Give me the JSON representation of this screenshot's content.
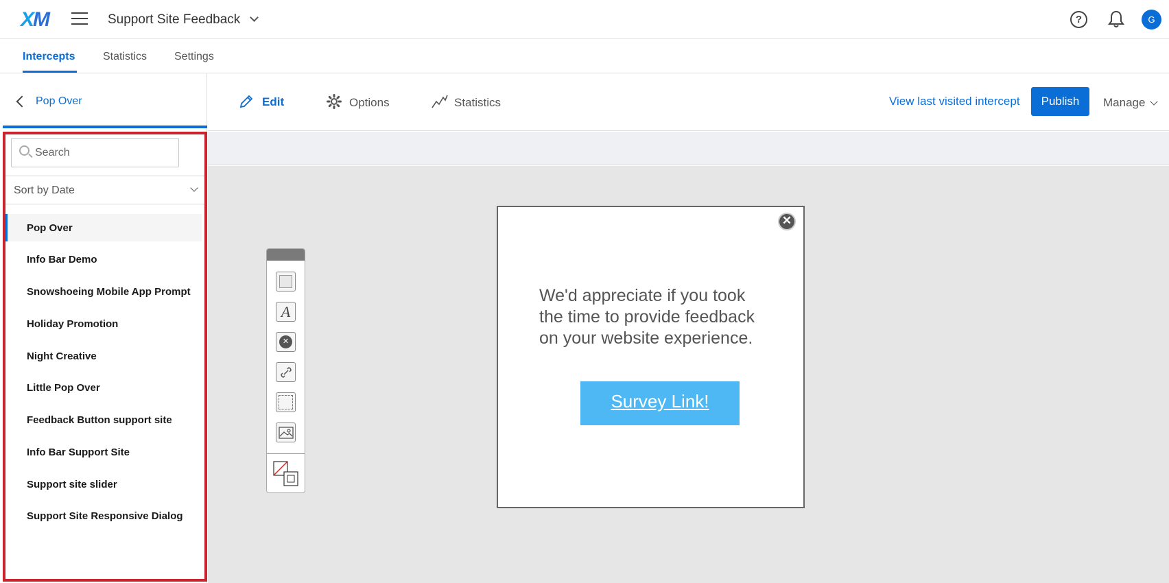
{
  "topbar": {
    "logo": "XM",
    "project_title": "Support Site Feedback",
    "help_glyph": "?",
    "avatar_initial": "G"
  },
  "subtabs": [
    {
      "label": "Intercepts",
      "active": true
    },
    {
      "label": "Statistics",
      "active": false
    },
    {
      "label": "Settings",
      "active": false
    }
  ],
  "left_panel": {
    "back_label": "Pop Over",
    "search_placeholder": "Search",
    "sort_label": "Sort by Date",
    "items": [
      {
        "label": "Pop Over",
        "selected": true
      },
      {
        "label": "Info Bar Demo"
      },
      {
        "label": "Snowshoeing Mobile App Prompt"
      },
      {
        "label": "Holiday Promotion"
      },
      {
        "label": "Night Creative"
      },
      {
        "label": "Little Pop Over"
      },
      {
        "label": "Feedback Button support site"
      },
      {
        "label": "Info Bar Support Site"
      },
      {
        "label": "Support site slider"
      },
      {
        "label": "Support Site Responsive Dialog"
      }
    ]
  },
  "editor_header": {
    "tabs": [
      {
        "label": "Edit",
        "icon": "pencil-icon",
        "active": true
      },
      {
        "label": "Options",
        "icon": "gear-icon",
        "active": false
      },
      {
        "label": "Statistics",
        "icon": "stats-line-icon",
        "active": false
      }
    ],
    "view_last_label": "View last visited intercept",
    "publish_label": "Publish",
    "manage_label": "Manage"
  },
  "toolbox": {
    "tools": [
      "rectangle-tool-icon",
      "text-tool-icon",
      "close-button-tool-icon",
      "link-tool-icon",
      "embedded-link-tool-icon",
      "image-tool-icon",
      "layer-color-tool-icon"
    ],
    "text_glyph": "A",
    "close_glyph": "✕"
  },
  "creative": {
    "close_glyph": "✕",
    "message": "We'd appreciate if you took the time to provide feedback on your website experience.",
    "button_label": "Survey Link!",
    "button_color": "#4db8f4"
  },
  "colors": {
    "accent": "#0b6ed6",
    "highlight_border": "#c8252f"
  }
}
